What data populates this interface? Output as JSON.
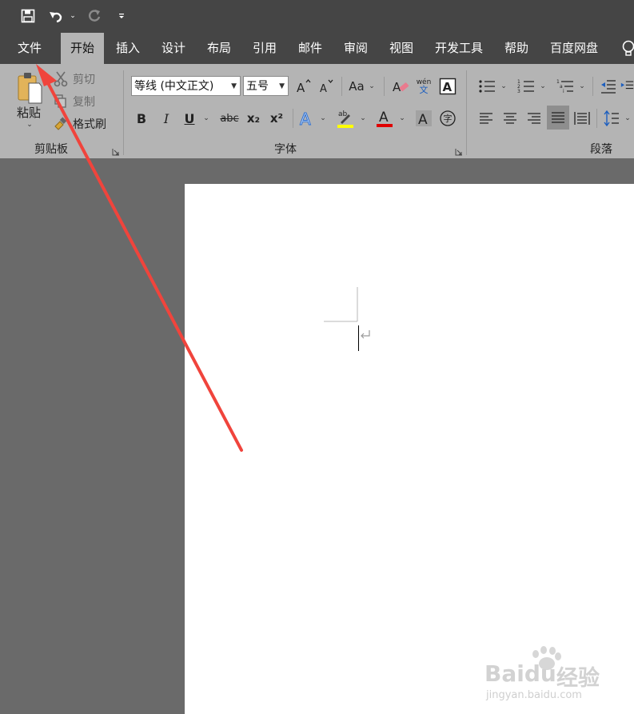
{
  "quick_access": {
    "save_icon": "save-icon",
    "undo_icon": "undo-icon",
    "redo_icon": "redo-icon",
    "customize_icon": "customize-qat-icon"
  },
  "tabs": [
    {
      "label": "文件"
    },
    {
      "label": "开始"
    },
    {
      "label": "插入"
    },
    {
      "label": "设计"
    },
    {
      "label": "布局"
    },
    {
      "label": "引用"
    },
    {
      "label": "邮件"
    },
    {
      "label": "审阅"
    },
    {
      "label": "视图"
    },
    {
      "label": "开发工具"
    },
    {
      "label": "帮助"
    },
    {
      "label": "百度网盘"
    }
  ],
  "active_tab": "开始",
  "clipboard": {
    "paste": "粘贴",
    "cut": "剪切",
    "copy": "复制",
    "format_painter": "格式刷",
    "group_label": "剪贴板"
  },
  "font": {
    "font_name": "等线 (中文正文)",
    "font_size": "五号",
    "change_case": "Aa",
    "bold": "B",
    "italic": "I",
    "underline": "U",
    "strike": "abc",
    "subscript": "x₂",
    "superscript": "x²",
    "group_label": "字体",
    "highlight_color": "#ffff00",
    "font_color": "#e00000",
    "phonetic_top": "wén",
    "phonetic_bottom": "文",
    "enclose_char": "字"
  },
  "paragraph": {
    "group_label": "段落"
  },
  "watermark": {
    "brand": "Baidu",
    "brand_cn": "经验",
    "url": "jingyan.baidu.com"
  },
  "colors": {
    "titlebar": "#454545",
    "ribbon": "#b4b4b4",
    "canvas": "#6a6a6a",
    "annotation_arrow": "#f0443c"
  }
}
